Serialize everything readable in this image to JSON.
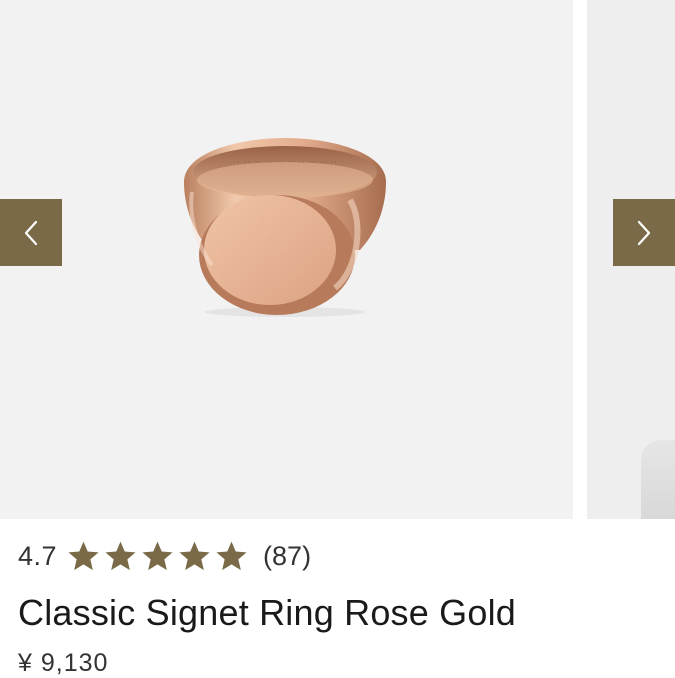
{
  "gallery": {
    "prev_icon": "chevron-left-icon",
    "next_icon": "chevron-right-icon",
    "accent_color": "#7a6a47",
    "image_alt": "rose gold signet ring"
  },
  "product": {
    "rating_value": "4.7",
    "rating_stars": 5,
    "rating_count": "(87)",
    "star_color": "#7a6a47",
    "title": "Classic Signet Ring Rose Gold",
    "price": "¥ 9,130"
  }
}
